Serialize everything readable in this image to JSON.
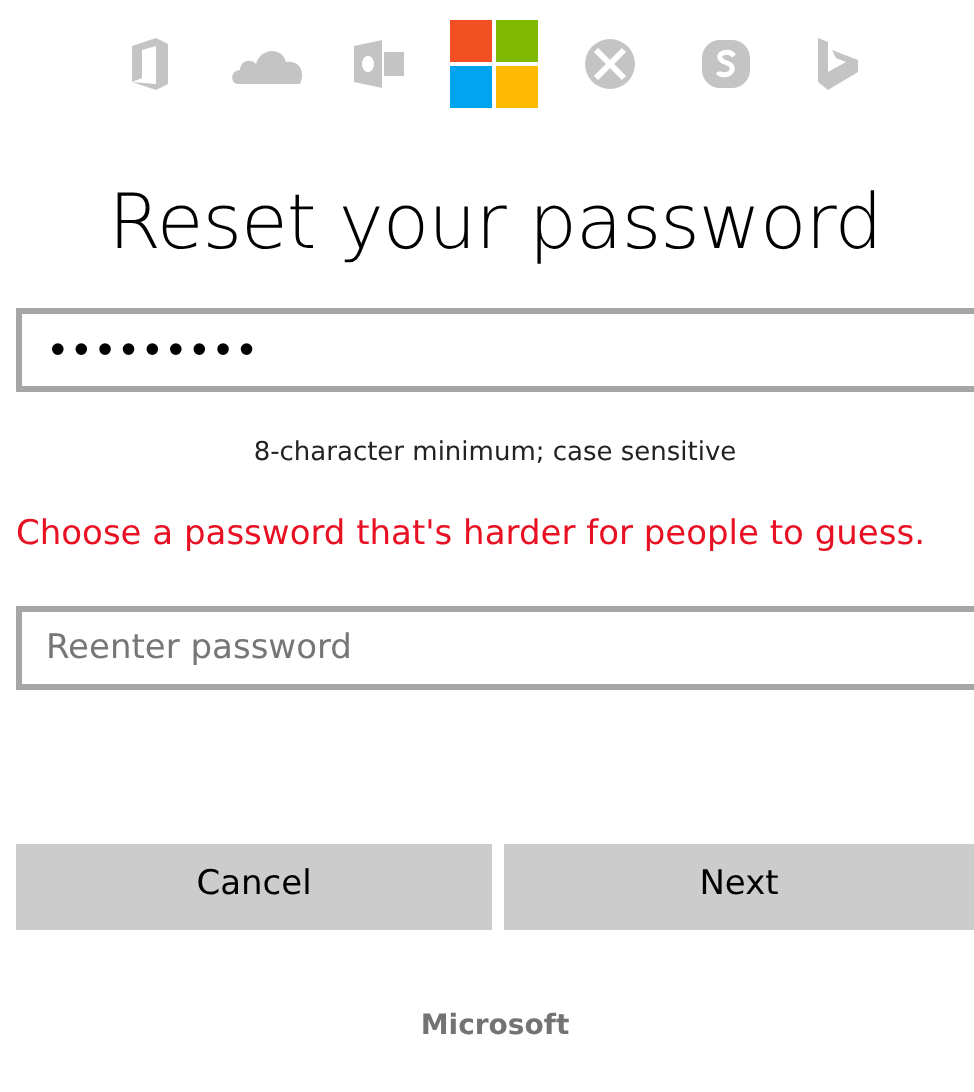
{
  "title": "Reset your password",
  "password_field": {
    "value": "•••••••••"
  },
  "hint": "8-character minimum; case sensitive",
  "error": "Choose a password that's harder for people to guess.",
  "reenter_field": {
    "placeholder": "Reenter password"
  },
  "buttons": [
    {
      "label": "Cancel"
    },
    {
      "label": "Next"
    }
  ],
  "footer": "Microsoft"
}
